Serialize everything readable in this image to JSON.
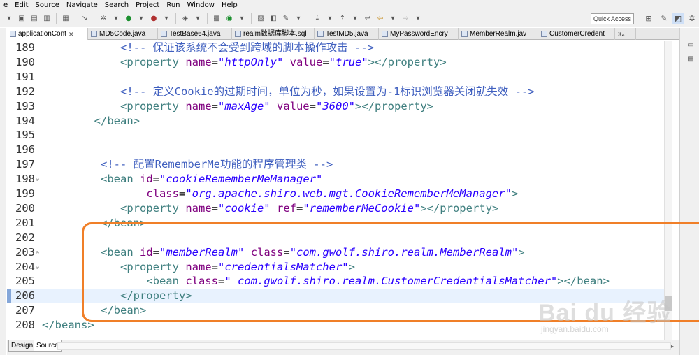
{
  "menu": [
    "e",
    "Edit",
    "Source",
    "Navigate",
    "Search",
    "Project",
    "Run",
    "Window",
    "Help"
  ],
  "toolbar": {
    "quick_access": "Quick Access"
  },
  "tabs": [
    {
      "label": "applicationCont",
      "active": true,
      "close": "✕"
    },
    {
      "label": "MD5Code.java"
    },
    {
      "label": "TestBase64.java"
    },
    {
      "label": "realm数据库脚本.sql"
    },
    {
      "label": "TestMD5.java"
    },
    {
      "label": "MyPasswordEncry"
    },
    {
      "label": "MemberRealm.jav"
    },
    {
      "label": "CustomerCredent"
    },
    {
      "label": "»₄"
    }
  ],
  "editor": {
    "lines": [
      {
        "num": "189",
        "parts": [
          [
            "p",
            "            "
          ],
          [
            "c",
            "<!-- 保证该系统不会受到跨域的脚本操作攻击 -->"
          ]
        ]
      },
      {
        "num": "190",
        "parts": [
          [
            "p",
            "            "
          ],
          [
            "t",
            "<property "
          ],
          [
            "a",
            "name"
          ],
          [
            "p",
            "="
          ],
          [
            "v",
            "\"httpOnly\""
          ],
          [
            "p",
            " "
          ],
          [
            "a",
            "value"
          ],
          [
            "p",
            "="
          ],
          [
            "v",
            "\"true\""
          ],
          [
            "t",
            "></property>"
          ]
        ]
      },
      {
        "num": "191",
        "parts": []
      },
      {
        "num": "192",
        "parts": [
          [
            "p",
            "            "
          ],
          [
            "c",
            "<!-- 定义Cookie的过期时间，单位为秒，如果设置为-1标识浏览器关闭就失效 -->"
          ]
        ]
      },
      {
        "num": "193",
        "parts": [
          [
            "p",
            "            "
          ],
          [
            "t",
            "<property "
          ],
          [
            "a",
            "name"
          ],
          [
            "p",
            "="
          ],
          [
            "v",
            "\"maxAge\""
          ],
          [
            "p",
            " "
          ],
          [
            "a",
            "value"
          ],
          [
            "p",
            "="
          ],
          [
            "v",
            "\"3600\""
          ],
          [
            "t",
            "></property>"
          ]
        ]
      },
      {
        "num": "194",
        "parts": [
          [
            "p",
            "        "
          ],
          [
            "t",
            "</bean>"
          ]
        ]
      },
      {
        "num": "195",
        "parts": []
      },
      {
        "num": "196",
        "parts": []
      },
      {
        "num": "197",
        "parts": [
          [
            "p",
            "         "
          ],
          [
            "c",
            "<!-- 配置RememberMe功能的程序管理类 -->"
          ]
        ]
      },
      {
        "num": "198",
        "fold": "⊖",
        "parts": [
          [
            "p",
            "         "
          ],
          [
            "t",
            "<bean "
          ],
          [
            "a",
            "id"
          ],
          [
            "p",
            "="
          ],
          [
            "v",
            "\"cookieRememberMeManager\""
          ]
        ]
      },
      {
        "num": "199",
        "parts": [
          [
            "p",
            "                "
          ],
          [
            "a",
            "class"
          ],
          [
            "p",
            "="
          ],
          [
            "v",
            "\"org.apache.shiro.web.mgt.CookieRememberMeManager\""
          ],
          [
            "t",
            ">"
          ]
        ]
      },
      {
        "num": "200",
        "parts": [
          [
            "p",
            "            "
          ],
          [
            "t",
            "<property "
          ],
          [
            "a",
            "name"
          ],
          [
            "p",
            "="
          ],
          [
            "v",
            "\"cookie\""
          ],
          [
            "p",
            " "
          ],
          [
            "a",
            "ref"
          ],
          [
            "p",
            "="
          ],
          [
            "v",
            "\"rememberMeCookie\""
          ],
          [
            "t",
            "></property>"
          ]
        ]
      },
      {
        "num": "201",
        "parts": [
          [
            "p",
            "         "
          ],
          [
            "t",
            "</bean>"
          ]
        ]
      },
      {
        "num": "202",
        "parts": []
      },
      {
        "num": "203",
        "fold": "⊖",
        "parts": [
          [
            "p",
            "         "
          ],
          [
            "t",
            "<bean "
          ],
          [
            "a",
            "id"
          ],
          [
            "p",
            "="
          ],
          [
            "v",
            "\"memberRealm\""
          ],
          [
            "p",
            " "
          ],
          [
            "a",
            "class"
          ],
          [
            "p",
            "="
          ],
          [
            "v",
            "\"com.gwolf.shiro.realm.MemberRealm\""
          ],
          [
            "t",
            ">"
          ]
        ]
      },
      {
        "num": "204",
        "fold": "⊖",
        "parts": [
          [
            "p",
            "            "
          ],
          [
            "t",
            "<property "
          ],
          [
            "a",
            "name"
          ],
          [
            "p",
            "="
          ],
          [
            "v",
            "\"credentialsMatcher\""
          ],
          [
            "t",
            ">"
          ]
        ]
      },
      {
        "num": "205",
        "parts": [
          [
            "p",
            "                "
          ],
          [
            "t",
            "<bean "
          ],
          [
            "a",
            "class"
          ],
          [
            "p",
            "="
          ],
          [
            "v",
            "\" com.gwolf.shiro.realm.CustomerCredentialsMatcher\""
          ],
          [
            "t",
            "></bean>"
          ]
        ]
      },
      {
        "num": "206",
        "current": true,
        "parts": [
          [
            "p",
            "            "
          ],
          [
            "t",
            "</property>"
          ]
        ]
      },
      {
        "num": "207",
        "parts": [
          [
            "p",
            "         "
          ],
          [
            "t",
            "</bean>"
          ]
        ]
      },
      {
        "num": "208",
        "parts": [
          [
            "t",
            "</beans>"
          ]
        ]
      }
    ]
  },
  "bottom_tabs": [
    "Design",
    "Source"
  ],
  "watermark": {
    "main": "Bai du 经验",
    "sub": "jingyan.baidu.com"
  },
  "colors": {
    "highlight": "#f07f28",
    "comment": "#3f5fbf",
    "tag": "#3f7f7f",
    "attr": "#7f007f",
    "value": "#2a00ff",
    "current_line": "#e8f2fe"
  }
}
